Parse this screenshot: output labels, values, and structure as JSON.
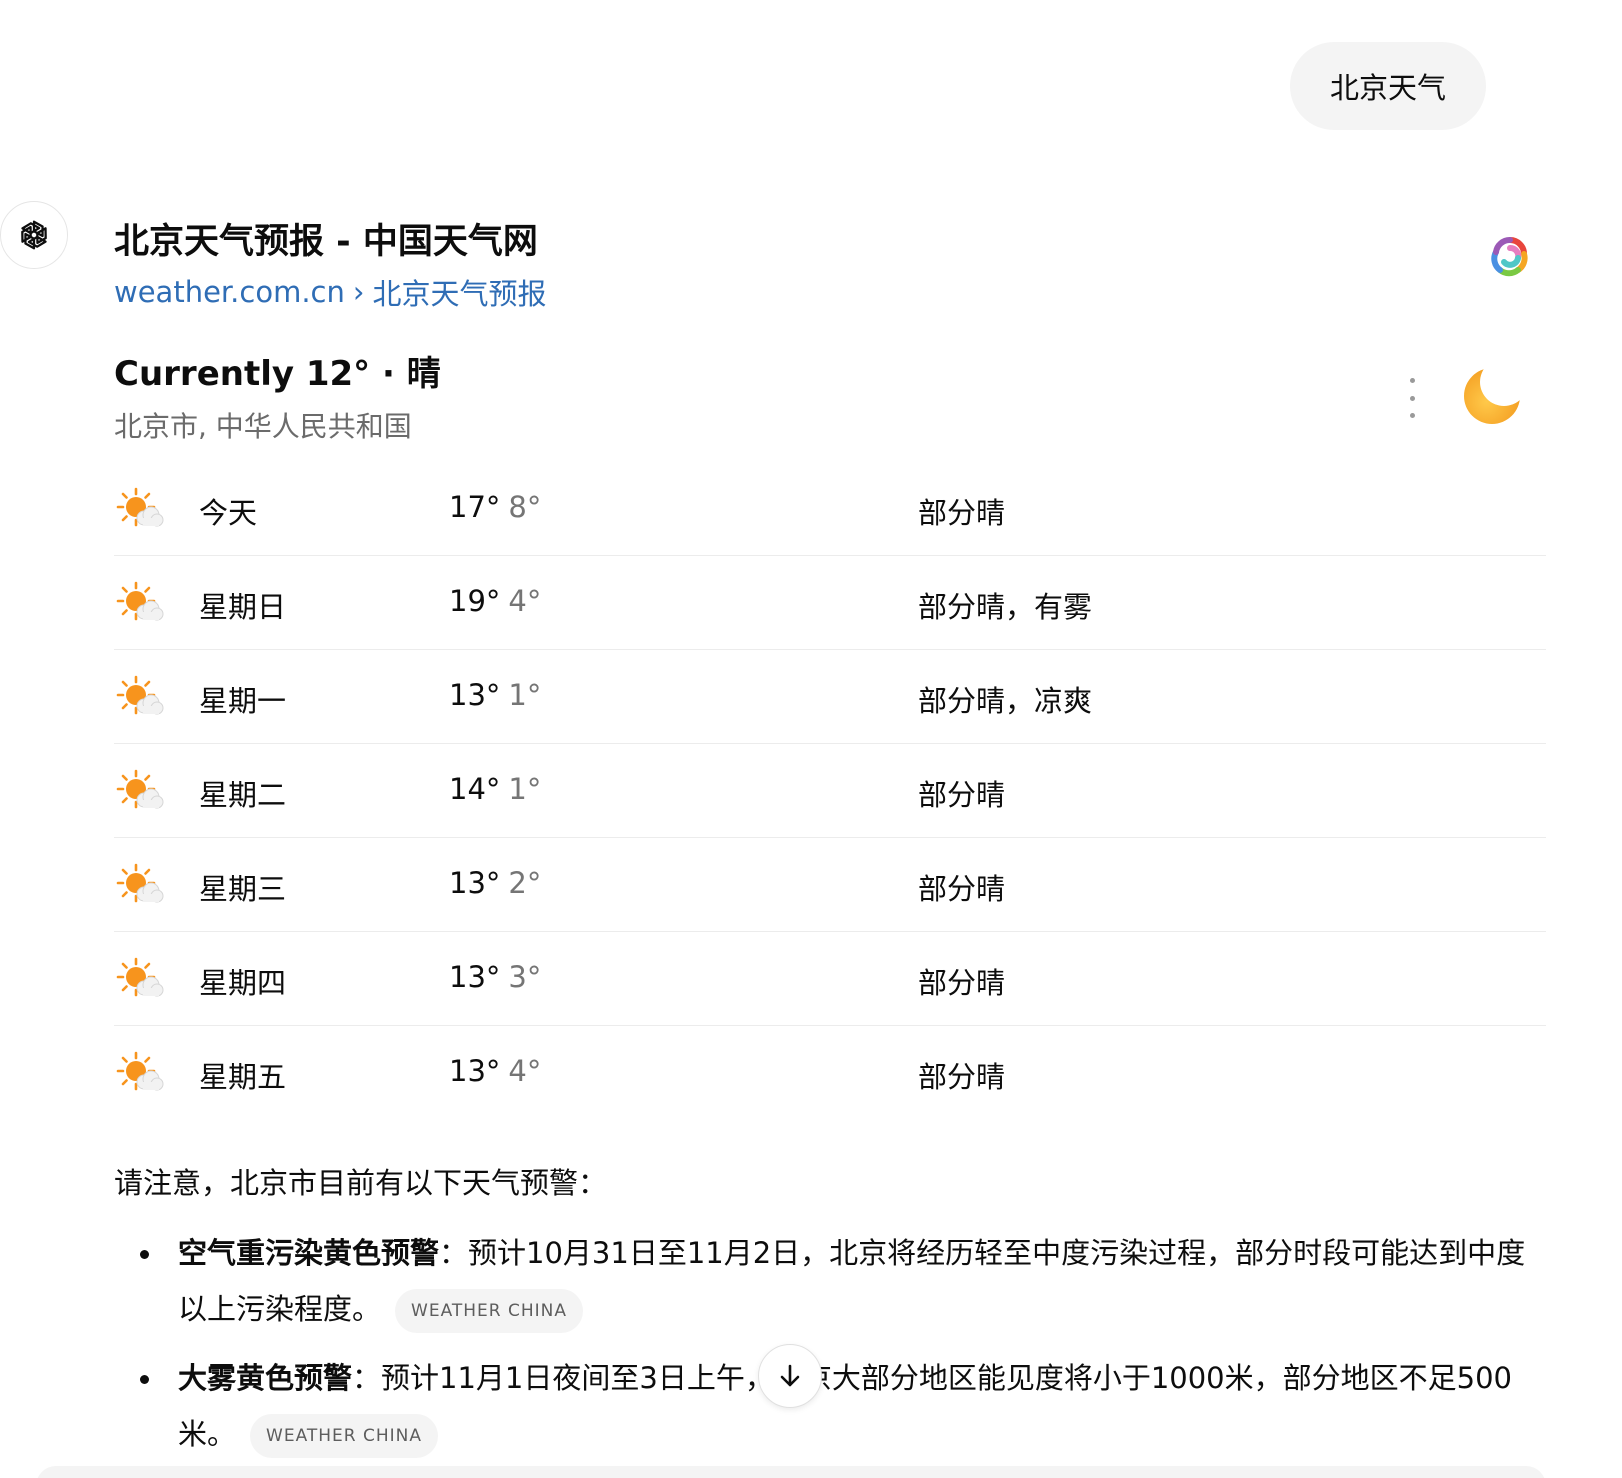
{
  "user_message": "北京天气",
  "source": {
    "title": "北京天气预报 - 中国天气网",
    "domain": "weather.com.cn",
    "breadcrumb_sep": "›",
    "path": "北京天气预报"
  },
  "current": {
    "label": "Currently 12° · 晴",
    "location": "北京市, 中华人民共和国",
    "icon": "moon-icon"
  },
  "forecast": [
    {
      "day": "今天",
      "high": "17°",
      "low": "8°",
      "condition": "部分晴",
      "icon": "partly-sunny-icon"
    },
    {
      "day": "星期日",
      "high": "19°",
      "low": "4°",
      "condition": "部分晴，有雾",
      "icon": "partly-sunny-icon"
    },
    {
      "day": "星期一",
      "high": "13°",
      "low": "1°",
      "condition": "部分晴，凉爽",
      "icon": "partly-sunny-icon"
    },
    {
      "day": "星期二",
      "high": "14°",
      "low": "1°",
      "condition": "部分晴",
      "icon": "partly-sunny-icon"
    },
    {
      "day": "星期三",
      "high": "13°",
      "low": "2°",
      "condition": "部分晴",
      "icon": "partly-sunny-icon"
    },
    {
      "day": "星期四",
      "high": "13°",
      "low": "3°",
      "condition": "部分晴",
      "icon": "partly-sunny-icon"
    },
    {
      "day": "星期五",
      "high": "13°",
      "low": "4°",
      "condition": "部分晴",
      "icon": "partly-sunny-icon"
    }
  ],
  "warnings": {
    "intro": "请注意，北京市目前有以下天气预警：",
    "items": [
      {
        "title": "空气重污染黄色预警",
        "sep": "：",
        "text": "预计10月31日至11月2日，北京将经历轻至中度污染过程，部分时段可能达到中度以上污染程度。",
        "citation": "WEATHER CHINA"
      },
      {
        "title": "大雾黄色预警",
        "sep": "：",
        "text": "预计11月1日夜间至3日上午，北京大部分地区能见度将小于1000米，部分地区不足500米。",
        "citation": "WEATHER CHINA"
      }
    ]
  },
  "colors": {
    "link": "#2f6db5",
    "sun": "#f7941d",
    "moon": "#f9b233",
    "muted": "#757575"
  }
}
